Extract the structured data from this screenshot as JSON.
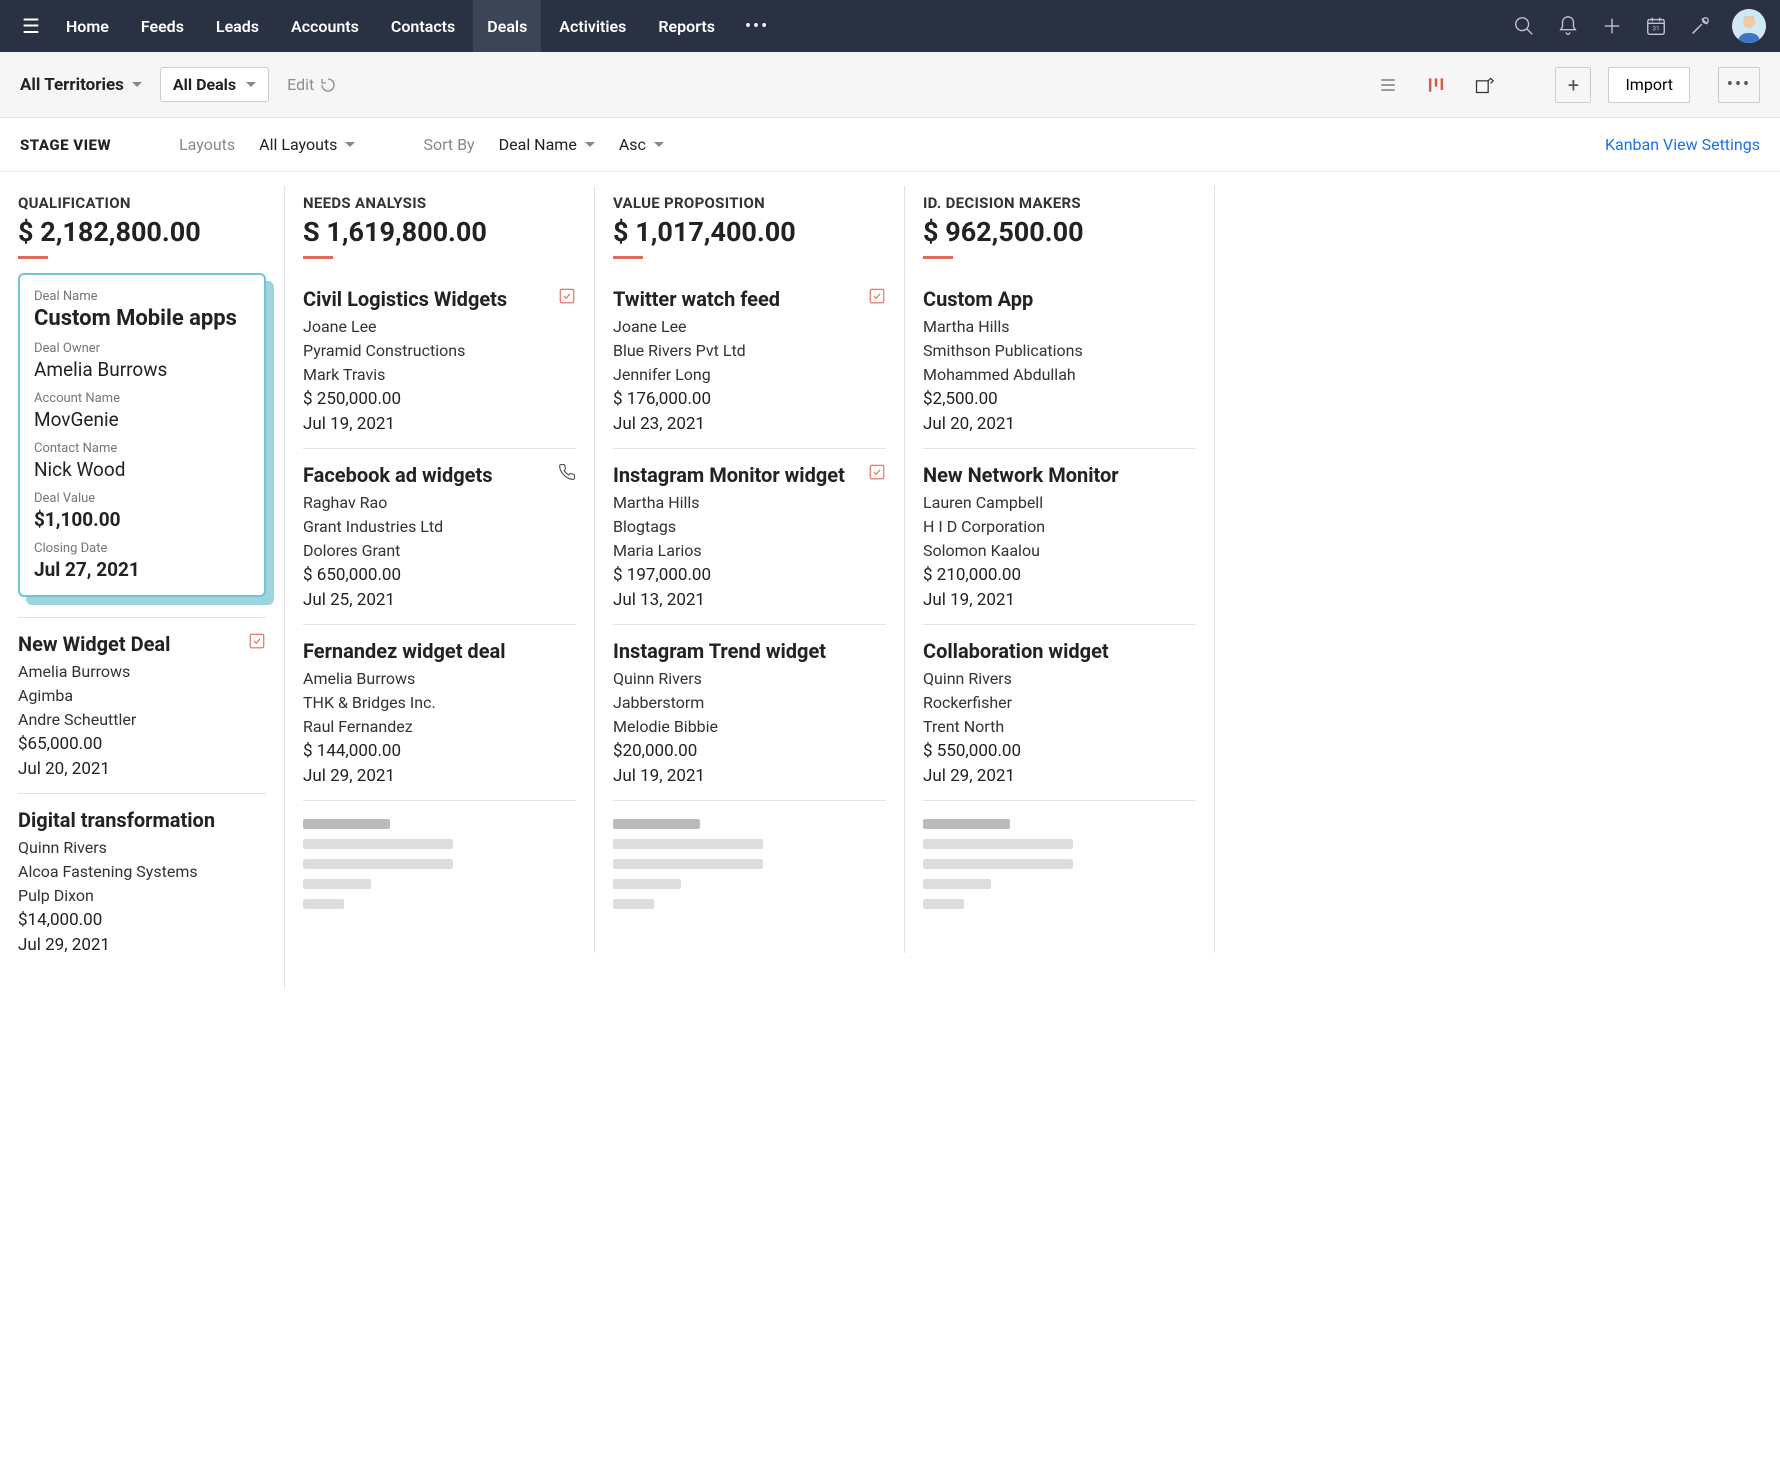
{
  "nav": {
    "home": "Home",
    "feeds": "Feeds",
    "leads": "Leads",
    "accounts": "Accounts",
    "contacts": "Contacts",
    "deals": "Deals",
    "activities": "Activities",
    "reports": "Reports"
  },
  "subbar": {
    "territories": "All Territories",
    "alldeals": "All Deals",
    "edit": "Edit",
    "import": "Import"
  },
  "ctrl": {
    "stageview": "STAGE VIEW",
    "layouts_lab": "Layouts",
    "layouts": "All Layouts",
    "sortby_lab": "Sort By",
    "sortby": "Deal Name",
    "order": "Asc",
    "settings": "Kanban View Settings"
  },
  "selcard": {
    "dealname_lab": "Deal Name",
    "dealname": "Custom Mobile apps",
    "owner_lab": "Deal Owner",
    "owner": "Amelia Burrows",
    "account_lab": "Account Name",
    "account": "MovGenie",
    "contact_lab": "Contact Name",
    "contact": "Nick Wood",
    "value_lab": "Deal Value",
    "value": "$1,100.00",
    "closing_lab": "Closing Date",
    "closing": "Jul 27, 2021"
  },
  "cols": [
    {
      "title": "QUALIFICATION",
      "amount": "$ 2,182,800.00",
      "cards": [
        {
          "name": "New Widget Deal",
          "owner": "Amelia Burrows",
          "account": "Agimba",
          "contact": "Andre Scheuttler",
          "value": "$65,000.00",
          "date": "Jul 20, 2021",
          "icon": "check"
        },
        {
          "name": "Digital transformation",
          "owner": "Quinn Rivers",
          "account": "Alcoa Fastening Systems",
          "contact": "Pulp Dixon",
          "value": "$14,000.00",
          "date": "Jul 29, 2021"
        }
      ]
    },
    {
      "title": "NEEDS ANALYSIS",
      "amount": "S 1,619,800.00",
      "cards": [
        {
          "name": "Civil Logistics Widgets",
          "owner": "Joane Lee",
          "account": "Pyramid Constructions",
          "contact": "Mark Travis",
          "value": "$ 250,000.00",
          "date": "Jul 19, 2021",
          "icon": "check"
        },
        {
          "name": "Facebook ad widgets",
          "owner": "Raghav Rao",
          "account": "Grant Industries Ltd",
          "contact": "Dolores Grant",
          "value": "$ 650,000.00",
          "date": "Jul 25, 2021",
          "icon": "phone"
        },
        {
          "name": "Fernandez widget deal",
          "owner": "Amelia Burrows",
          "account": "THK & Bridges Inc.",
          "contact": "Raul Fernandez",
          "value": "$ 144,000.00",
          "date": "Jul 29, 2021"
        }
      ]
    },
    {
      "title": "VALUE PROPOSITION",
      "amount": "$ 1,017,400.00",
      "cards": [
        {
          "name": "Twitter watch feed",
          "owner": "Joane Lee",
          "account": "Blue Rivers Pvt Ltd",
          "contact": "Jennifer Long",
          "value": "$ 176,000.00",
          "date": "Jul 23, 2021",
          "icon": "check"
        },
        {
          "name": "Instagram Monitor widget",
          "owner": "Martha Hills",
          "account": "Blogtags",
          "contact": "Maria Larios",
          "value": "$ 197,000.00",
          "date": "Jul 13, 2021",
          "icon": "check"
        },
        {
          "name": "Instagram Trend widget",
          "owner": "Quinn Rivers",
          "account": "Jabberstorm",
          "contact": "Melodie Bibbie",
          "value": "$20,000.00",
          "date": "Jul 19, 2021"
        }
      ]
    },
    {
      "title": "ID. DECISION MAKERS",
      "amount": "$ 962,500.00",
      "cards": [
        {
          "name": "Custom App",
          "owner": "Martha Hills",
          "account": "Smithson Publications",
          "contact": "Mohammed Abdullah",
          "value": "$2,500.00",
          "date": "Jul 20, 2021"
        },
        {
          "name": "New Network Monitor",
          "owner": "Lauren Campbell",
          "account": "H I D Corporation",
          "contact": "Solomon Kaalou",
          "value": "$ 210,000.00",
          "date": "Jul 19, 2021"
        },
        {
          "name": "Collaboration widget",
          "owner": "Quinn Rivers",
          "account": "Rockerfisher",
          "contact": "Trent North",
          "value": "$ 550,000.00",
          "date": "Jul 29, 2021"
        }
      ]
    }
  ]
}
